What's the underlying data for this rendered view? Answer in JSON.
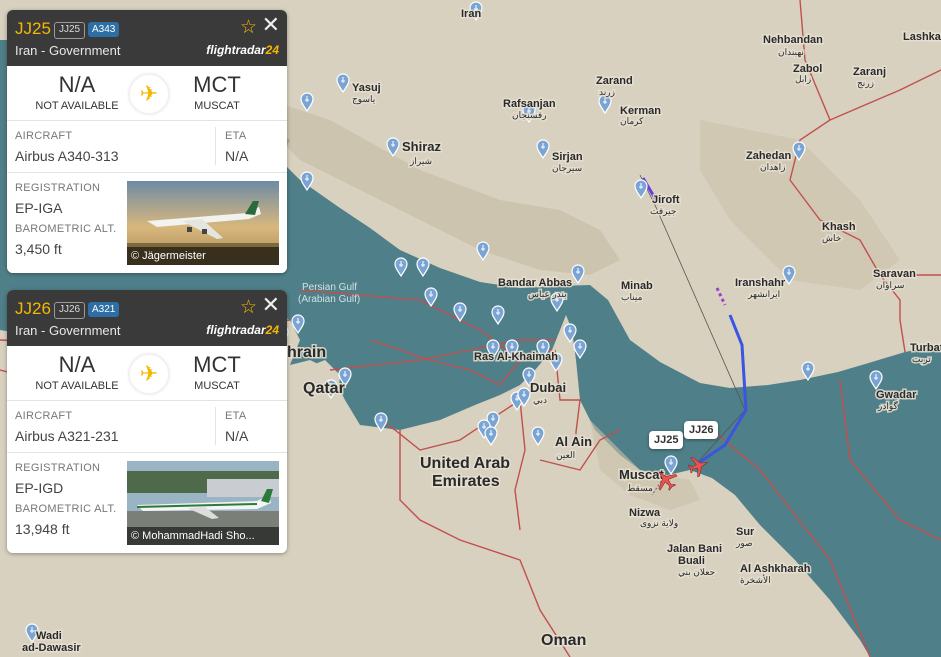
{
  "map": {
    "countries": {
      "iran": "Iran",
      "uae": "United Arab\nEmirates",
      "uae_line1": "United Arab",
      "uae_line2": "Emirates",
      "oman": "Oman",
      "qatar": "Qatar",
      "bahrain": "hrain"
    },
    "water": {
      "gulf_line1": "Persian Gulf",
      "gulf_line2": "(Arabian Gulf)"
    },
    "cities": {
      "nehbandan": "Nehbandan",
      "nehbandan_ar": "نهبندان",
      "lashkar": "Lashkar",
      "zabol": "Zabol",
      "zabol_ar": "زابل",
      "zaranj": "Zaranj",
      "zaranj_ar": "زرنج",
      "zarand": "Zarand",
      "zarand_ar": "زرند",
      "kerman": "Kerman",
      "kerman_ar": "کرمان",
      "rafsanjan": "Rafsanjan",
      "rafsanjan_ar": "رفسنجان",
      "yasuj": "Yasuj",
      "yasuj_ar": "یاسوج",
      "shiraz": "Shiraz",
      "shiraz_ar": "شیراز",
      "sirjan": "Sirjan",
      "sirjan_ar": "سیرجان",
      "zahedan": "Zahedan",
      "zahedan_ar": "زاهدان",
      "jiroft": "Jiroft",
      "jiroft_ar": "جيرفت",
      "khash": "Khash",
      "khash_ar": "خاش",
      "bandar_abbas": "Bandar Abbas",
      "bandar_abbas_ar": "بندر عباس",
      "minab": "Minab",
      "minab_ar": "میناب",
      "iranshahr": "Iranshahr",
      "iranshahr_ar": "ایرانشهر",
      "saravan": "Saravan",
      "saravan_ar": "سراوان",
      "turbat": "Turbat",
      "turbat_ar": "تربت",
      "gwadar": "Gwadar",
      "gwadar_ar": "گوادر",
      "ras_al_khaimah": "Ras Al-Khaimah",
      "dubai": "Dubai",
      "dubai_ar": "دبي",
      "al_ain": "Al Ain",
      "al_ain_ar": "العين",
      "muscat": "Muscat",
      "muscat_ar": "مسقط",
      "nizwa": "Nizwa",
      "nizwa_ar": "ولاية نزوى",
      "sur": "Sur",
      "sur_ar": "صور",
      "jalan1": "Jalan Bani",
      "jalan2": "Buali",
      "jalan_ar": "جعلان بني",
      "ashkharah": "Al Ashkharah",
      "ashkharah_ar": "الأشخرة",
      "wadi1": "Wadi",
      "wadi2": "ad-Dawasir"
    },
    "flight_labels": {
      "jj25": "JJ25",
      "jj26": "JJ26"
    }
  },
  "cards": [
    {
      "callsign": "JJ25",
      "reg_badge": "JJ25",
      "type_badge": "A343",
      "owner": "Iran - Government",
      "brand_prefix": "flightradar",
      "brand_suffix": "24",
      "origin_code": "N/A",
      "origin_name": "NOT AVAILABLE",
      "dest_code": "MCT",
      "dest_name": "MUSCAT",
      "aircraft_label": "AIRCRAFT",
      "aircraft": "Airbus A340-313",
      "eta_label": "ETA",
      "eta": "N/A",
      "registration_label": "REGISTRATION",
      "registration": "EP-IGA",
      "alt_label": "BAROMETRIC ALT.",
      "altitude": "3,450 ft",
      "photo_credit": "© Jägermeister"
    },
    {
      "callsign": "JJ26",
      "reg_badge": "JJ26",
      "type_badge": "A321",
      "owner": "Iran - Government",
      "brand_prefix": "flightradar",
      "brand_suffix": "24",
      "origin_code": "N/A",
      "origin_name": "NOT AVAILABLE",
      "dest_code": "MCT",
      "dest_name": "MUSCAT",
      "aircraft_label": "AIRCRAFT",
      "aircraft": "Airbus A321-231",
      "eta_label": "ETA",
      "eta": "N/A",
      "registration_label": "REGISTRATION",
      "registration": "EP-IGD",
      "alt_label": "BAROMETRIC ALT.",
      "altitude": "13,948 ft",
      "photo_credit": "© MohammadHadi Sho..."
    }
  ],
  "icons": {
    "star": "star-icon",
    "close": "close-icon",
    "plane": "plane-icon",
    "airport": "airport-pin-icon"
  },
  "colors": {
    "callsign": "#f5b800",
    "sea": "#4f7f88",
    "land": "#d9d3c3",
    "border": "#c0504d",
    "aircraft": "#e8554e"
  }
}
